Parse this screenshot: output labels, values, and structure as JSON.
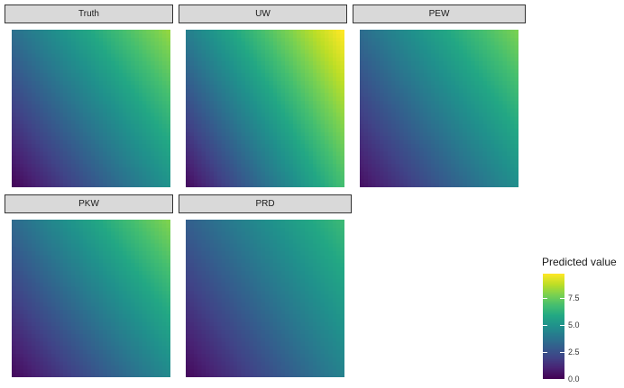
{
  "chart_data": {
    "type": "heatmap",
    "legend": {
      "title": "Predicted value",
      "placement": "right",
      "breaks": [
        0.0,
        2.5,
        5.0,
        7.5
      ],
      "break_labels": [
        "0.0",
        "2.5",
        "5.0",
        "7.5"
      ],
      "range": [
        0,
        9.8
      ],
      "colormap": "viridis"
    },
    "facets": [
      {
        "label": "Truth",
        "corner_values": {
          "bottom_left": 0.2,
          "bottom_right": 5.0,
          "top_left": 3.6,
          "top_right": 8.2
        }
      },
      {
        "label": "UW",
        "corner_values": {
          "bottom_left": 0.4,
          "bottom_right": 6.8,
          "top_left": 4.2,
          "top_right": 9.8
        }
      },
      {
        "label": "PEW",
        "corner_values": {
          "bottom_left": 0.5,
          "bottom_right": 4.8,
          "top_left": 3.5,
          "top_right": 7.8
        }
      },
      {
        "label": "PKW",
        "corner_values": {
          "bottom_left": 0.3,
          "bottom_right": 4.6,
          "top_left": 3.4,
          "top_right": 7.9
        }
      },
      {
        "label": "PRD",
        "corner_values": {
          "bottom_left": 0.3,
          "bottom_right": 4.3,
          "top_left": 3.0,
          "top_right": 6.6
        }
      }
    ],
    "grid": false
  }
}
